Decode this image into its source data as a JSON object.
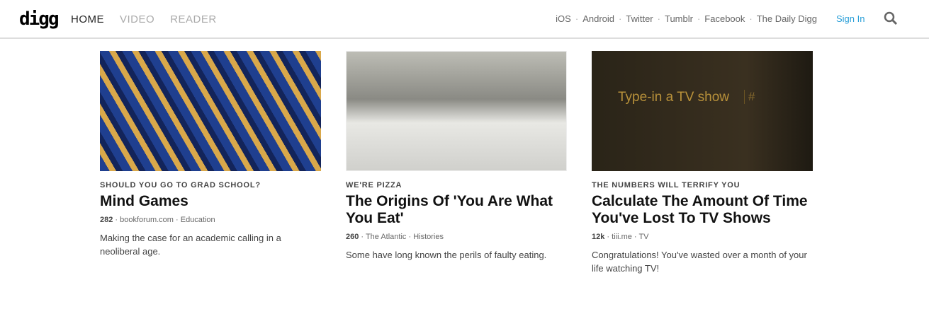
{
  "header": {
    "logo": "digg",
    "nav": [
      "HOME",
      "VIDEO",
      "READER"
    ],
    "links": [
      "iOS",
      "Android",
      "Twitter",
      "Tumblr",
      "Facebook",
      "The Daily Digg"
    ],
    "sign_in": "Sign In"
  },
  "cards": [
    {
      "kicker": "SHOULD YOU GO TO GRAD SCHOOL?",
      "title": "Mind Games",
      "count": "282",
      "source": "bookforum.com",
      "category": "Education",
      "desc": "Making the case for an academic calling in a neoliberal age."
    },
    {
      "kicker": "WE'RE PIZZA",
      "title": "The Origins Of 'You Are What You Eat'",
      "count": "260",
      "source": "The Atlantic",
      "category": "Histories",
      "desc": "Some have long known the perils of faulty eating."
    },
    {
      "kicker": "THE NUMBERS WILL TERRIFY YOU",
      "title": "Calculate The Amount Of Time You've Lost To TV Shows",
      "count": "12k",
      "source": "tiii.me",
      "category": "TV",
      "desc": "Congratulations! You've wasted over a month of your life watching TV!",
      "image_text": "Type-in a TV show",
      "image_hash": "#"
    }
  ]
}
